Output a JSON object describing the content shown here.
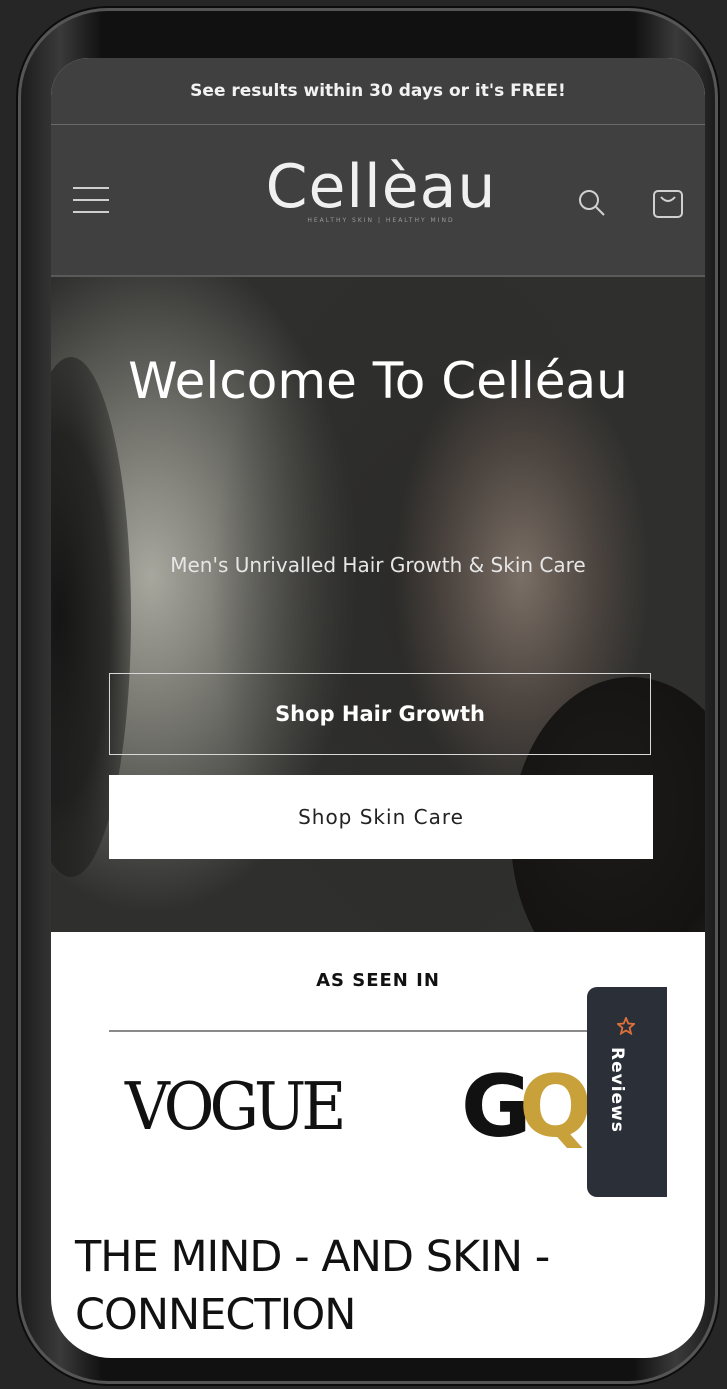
{
  "announcement": {
    "text": "See results within 30 days or it's FREE!"
  },
  "header": {
    "logo_text": "Cellèau",
    "logo_tagline": "HEALTHY SKIN | HEALTHY MIND",
    "menu_icon": "hamburger-menu-icon",
    "search_icon": "search-icon",
    "cart_icon": "cart-icon"
  },
  "hero": {
    "title": "Welcome To Celléau",
    "subtitle": "Men's Unrivalled Hair Growth & Skin Care",
    "buttons": {
      "primary_label": "Shop Hair Growth",
      "secondary_label": "Shop Skin Care"
    }
  },
  "seen_in": {
    "title": "AS SEEN IN",
    "logos": [
      "VOGUE",
      "GQ"
    ]
  },
  "reviews_tab": {
    "label": "Reviews",
    "icon": "star-icon"
  },
  "section": {
    "heading": "THE MIND - AND SKIN - CONNECTION"
  },
  "colors": {
    "header_bg": "#404040",
    "reviews_tab_bg": "#2b3038",
    "gq_gold": "#c9a13b",
    "reviews_icon": "#e0703a"
  }
}
